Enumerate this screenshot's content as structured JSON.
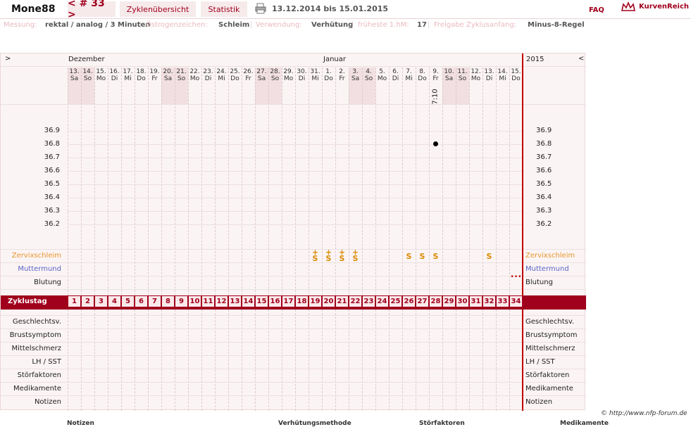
{
  "header": {
    "user": "Mone88",
    "cycle_nav": "< # 33 >",
    "tab_overview": "Zyklenübersicht",
    "tab_stats": "Statistik",
    "date_range": "13.12.2014 bis 15.01.2015",
    "faq": "FAQ",
    "brand": "KurvenReich"
  },
  "settings": {
    "messung_label": "Messung:",
    "messung": "rektal / analog / 3 Minuten",
    "oestro_label": "Östrogenzeichen:",
    "oestro": "Schleim",
    "verwendung_label": "Verwendung:",
    "verwendung": "Verhütung",
    "frueh_label": "früheste 1.hM:",
    "frueh": "17",
    "freigabe_label": "Freigabe Zyklusanfang:",
    "freigabe": "Minus-8-Regel",
    "sep": "|"
  },
  "chart_nav": {
    "prev": ">",
    "next": "<",
    "year": "2015",
    "month_dec": "Dezember",
    "month_jan": "Januar"
  },
  "chart_data": {
    "type": "table",
    "days": [
      {
        "date": "13.",
        "wd": "Sa"
      },
      {
        "date": "14.",
        "wd": "So"
      },
      {
        "date": "15.",
        "wd": "Mo"
      },
      {
        "date": "16.",
        "wd": "Di"
      },
      {
        "date": "17.",
        "wd": "Mi"
      },
      {
        "date": "18.",
        "wd": "Do"
      },
      {
        "date": "19.",
        "wd": "Fr"
      },
      {
        "date": "20.",
        "wd": "Sa"
      },
      {
        "date": "21.",
        "wd": "So"
      },
      {
        "date": "22.",
        "wd": "Mo"
      },
      {
        "date": "23.",
        "wd": "Di"
      },
      {
        "date": "24.",
        "wd": "Mi"
      },
      {
        "date": "25.",
        "wd": "Do"
      },
      {
        "date": "26.",
        "wd": "Fr"
      },
      {
        "date": "27.",
        "wd": "Sa"
      },
      {
        "date": "28.",
        "wd": "So"
      },
      {
        "date": "29.",
        "wd": "Mo"
      },
      {
        "date": "30.",
        "wd": "Di"
      },
      {
        "date": "31.",
        "wd": "Mi"
      },
      {
        "date": "1.",
        "wd": "Do"
      },
      {
        "date": "2.",
        "wd": "Fr"
      },
      {
        "date": "3.",
        "wd": "Sa"
      },
      {
        "date": "4.",
        "wd": "So"
      },
      {
        "date": "5.",
        "wd": "Mo"
      },
      {
        "date": "6.",
        "wd": "Di"
      },
      {
        "date": "7.",
        "wd": "Mi"
      },
      {
        "date": "8.",
        "wd": "Do"
      },
      {
        "date": "9.",
        "wd": "Fr"
      },
      {
        "date": "10.",
        "wd": "Sa"
      },
      {
        "date": "11.",
        "wd": "So"
      },
      {
        "date": "12.",
        "wd": "Mo"
      },
      {
        "date": "13.",
        "wd": "Di"
      },
      {
        "date": "14.",
        "wd": "Mi"
      },
      {
        "date": "15.",
        "wd": "Do"
      }
    ],
    "weekend_cols": [
      0,
      1,
      7,
      8,
      14,
      15,
      21,
      22,
      28,
      29
    ],
    "temp_ticks": [
      "36.9",
      "36.8",
      "36.7",
      "36.6",
      "36.5",
      "36.4",
      "36.3",
      "36.2"
    ],
    "temp_range": [
      36.2,
      36.9
    ],
    "measurement": {
      "day": 28,
      "value": 36.8,
      "time": "7:10"
    },
    "zervix": [
      {
        "day": 19,
        "sym": "S+"
      },
      {
        "day": 20,
        "sym": "S+"
      },
      {
        "day": 21,
        "sym": "S+"
      },
      {
        "day": 22,
        "sym": "S+"
      },
      {
        "day": 26,
        "sym": "S"
      },
      {
        "day": 27,
        "sym": "S"
      },
      {
        "day": 28,
        "sym": "S"
      },
      {
        "day": 32,
        "sym": "S"
      }
    ],
    "bleeding": {
      "day": 34,
      "sym": "•••"
    },
    "cycle_days": [
      "1",
      "2",
      "3",
      "4",
      "5",
      "6",
      "7",
      "8",
      "9",
      "10",
      "11",
      "12",
      "13",
      "14",
      "15",
      "16",
      "17",
      "18",
      "19",
      "20",
      "21",
      "22",
      "23",
      "24",
      "25",
      "26",
      "27",
      "28",
      "29",
      "30",
      "31",
      "32",
      "33",
      "34"
    ]
  },
  "rows": {
    "zervix": "Zervixschleim",
    "muttermund": "Muttermund",
    "blutung": "Blutung",
    "zyklustag": "Zyklustag",
    "extra": [
      "Geschlechtsv.",
      "Brustsymptom",
      "Mittelschmerz",
      "LH / SST",
      "Störfaktoren",
      "Medikamente",
      "Notizen"
    ]
  },
  "colors": {
    "accent": "#a0001c",
    "zervix": "#e8962a",
    "muttermund": "#5a64c8",
    "today": "#c00000"
  },
  "footer": {
    "copy": "© http://www.nfp-forum.de",
    "notizen": "Notizen",
    "verhuetung": "Verhütungsmethode",
    "stoer": "Störfaktoren",
    "medi": "Medikamente"
  }
}
